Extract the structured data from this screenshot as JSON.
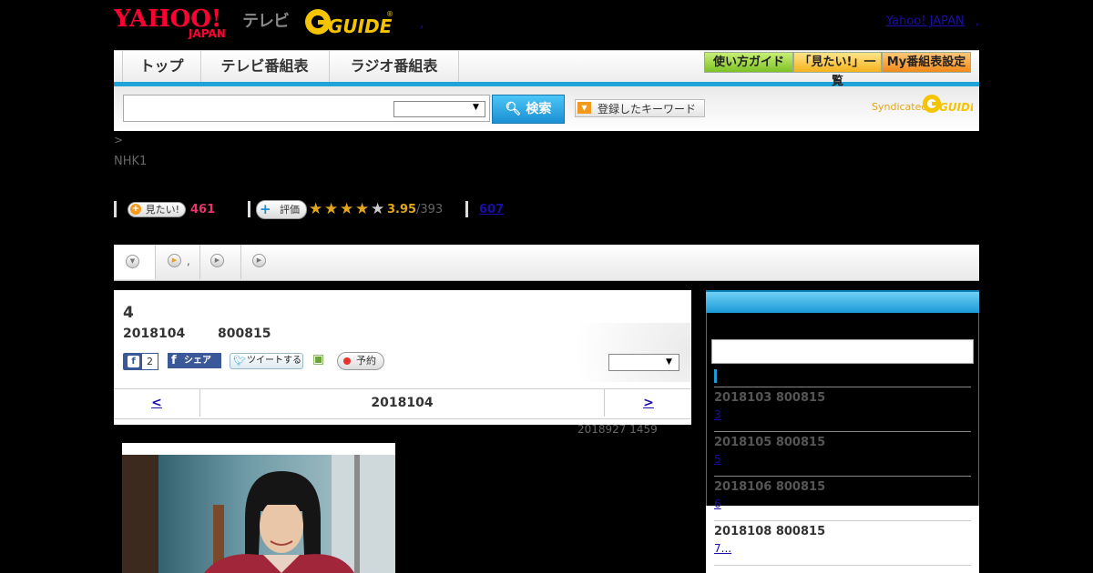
{
  "header": {
    "logo_yahoo_line1": "YAHOO!",
    "logo_yahoo_line2": "JAPAN",
    "logo_terebi": "テレビ",
    "logo_gguide": "G GUIDE",
    "dot": ",",
    "yahoo_japan_link": "Yahoo! JAPAN",
    "yahoo_japan_dot": ","
  },
  "nav": {
    "tabs": [
      "トップ",
      "テレビ番組表",
      "ラジオ番組表"
    ],
    "buttons": [
      "使い方ガイド",
      "「見たい!」一覧",
      "My番組表設定"
    ]
  },
  "search": {
    "input_value": "",
    "select_value": "",
    "button_label": "検索",
    "keyword_button": "登録したキーワード",
    "syndicated": "Syndicated",
    "syndicated_logo": "G GUIDE"
  },
  "breadcrumb": ">",
  "channel": "NHK1",
  "stats": {
    "mitai_label": "見たい!",
    "mitai_count": "461",
    "eval_label": "評価",
    "rating_value": 3.95,
    "rating_text": "3.95",
    "rating_count": "/393",
    "link_count": "607",
    "colors": {
      "mitai": "#e8336d",
      "rating": "#e2a51c",
      "star_off": "#cccccc"
    }
  },
  "tabs_strip": {
    "tab2_text": ","
  },
  "program": {
    "title": "4",
    "date": "2018104",
    "time": "800815",
    "fb_like_count": "2",
    "fb_share": "シェア",
    "tweet": "ツイートする",
    "reserve": "予約",
    "panel_select_value": "",
    "nav_prev": "<",
    "nav_date": "2018104",
    "nav_next": ">",
    "updated": "2018927  1459"
  },
  "sidebar": {
    "episodes": [
      {
        "date": "2018103  800815",
        "link": "3"
      },
      {
        "date": "2018105  800815",
        "link": "5"
      },
      {
        "date": "2018106  800815",
        "link": "6"
      },
      {
        "date": "2018108  800815",
        "link": "7..."
      }
    ]
  },
  "colors": {
    "accent_blue": "#1fa3d8",
    "link": "#1a0dab",
    "page_bg": "#000000"
  },
  "icons": [
    "search-icon",
    "plus-icon",
    "star-icon",
    "play-icon",
    "facebook-icon",
    "twitter-icon",
    "calendar-plus-icon",
    "record-icon",
    "dropdown-arrow-icon"
  ]
}
